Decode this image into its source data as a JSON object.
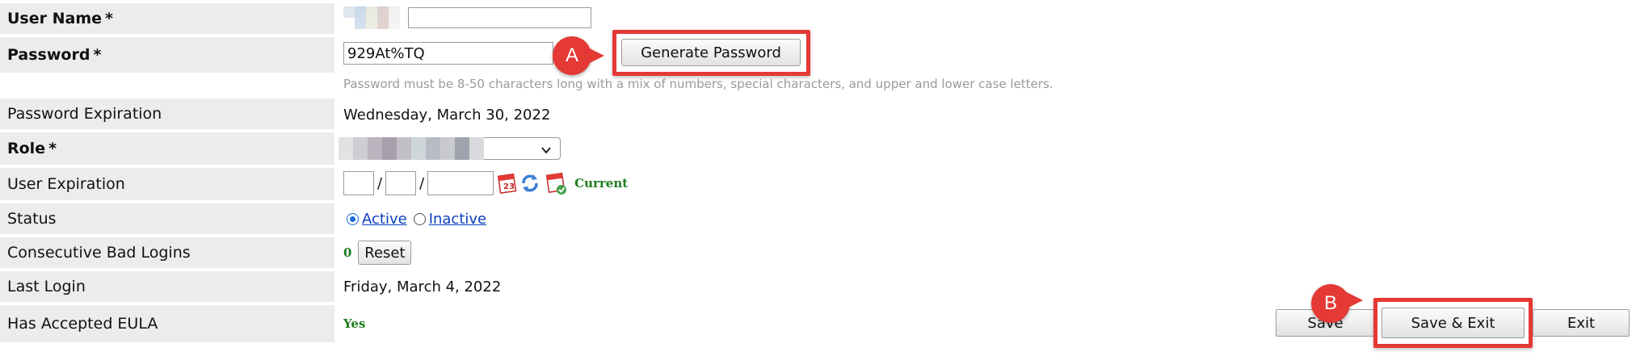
{
  "form": {
    "user_name": {
      "label": "User Name",
      "required_marker": "*",
      "value": ""
    },
    "password": {
      "label": "Password",
      "required_marker": "*",
      "value": "929At%TQ",
      "generate_button": "Generate Password",
      "hint": "Password must be 8-50 characters long with a mix of numbers, special characters, and upper and lower case letters."
    },
    "password_expiration": {
      "label": "Password Expiration",
      "value": "Wednesday, March 30, 2022"
    },
    "role": {
      "label": "Role",
      "required_marker": "*",
      "selected": ""
    },
    "user_expiration": {
      "label": "User Expiration",
      "separator": "/",
      "month": "",
      "day": "",
      "year": "",
      "current_label": "Current"
    },
    "status": {
      "label": "Status",
      "options": [
        "Active",
        "Inactive"
      ],
      "selected": "Active"
    },
    "consecutive_bad_logins": {
      "label": "Consecutive Bad Logins",
      "value": "0",
      "reset_button": "Reset"
    },
    "last_login": {
      "label": "Last Login",
      "value": "Friday, March 4, 2022"
    },
    "has_accepted_eula": {
      "label": "Has Accepted EULA",
      "value": "Yes"
    }
  },
  "actions": {
    "save": "Save",
    "save_exit": "Save & Exit",
    "exit": "Exit"
  },
  "callouts": {
    "a": "A",
    "b": "B"
  },
  "colors": {
    "annotation_red": "#e53935",
    "label_bg": "#ececec",
    "success_green": "#1e7d1e",
    "link_blue": "#0b3fbf"
  },
  "icons": [
    "calendar-icon",
    "refresh-icon",
    "calendar-check-icon",
    "chevron-down-icon"
  ]
}
